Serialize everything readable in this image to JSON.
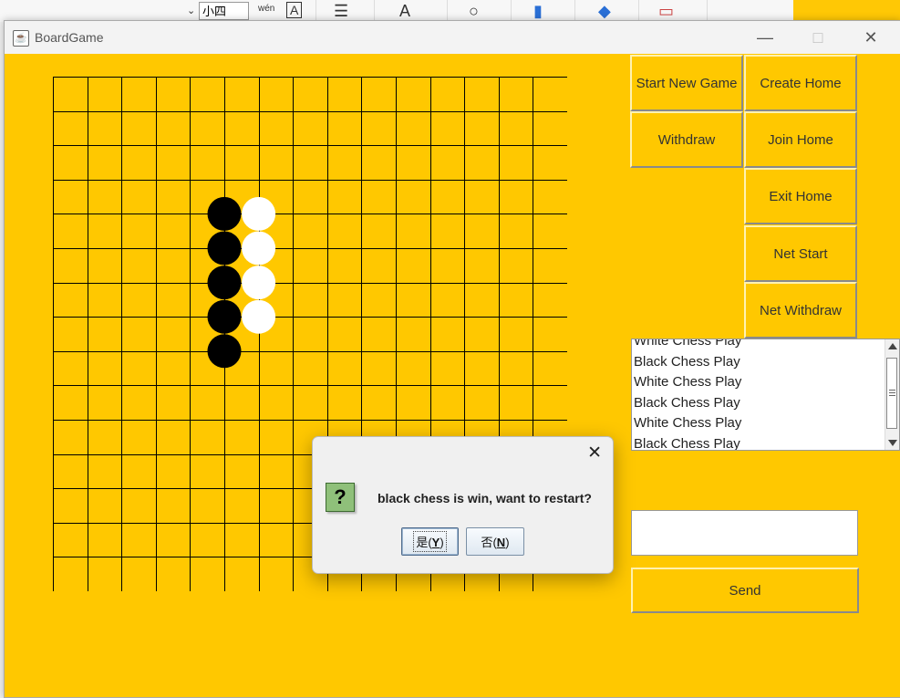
{
  "background_app": {
    "font_size_select": "小四",
    "pinyin_label": "wén",
    "text_icon": "A"
  },
  "window": {
    "title": "BoardGame",
    "icon": "java-cup-icon"
  },
  "board": {
    "grid_lines": 16,
    "stones": [
      {
        "color": "black",
        "col": 5,
        "row": 4
      },
      {
        "color": "white",
        "col": 6,
        "row": 4
      },
      {
        "color": "black",
        "col": 5,
        "row": 5
      },
      {
        "color": "white",
        "col": 6,
        "row": 5
      },
      {
        "color": "black",
        "col": 5,
        "row": 6
      },
      {
        "color": "white",
        "col": 6,
        "row": 6
      },
      {
        "color": "black",
        "col": 5,
        "row": 7
      },
      {
        "color": "white",
        "col": 6,
        "row": 7
      },
      {
        "color": "black",
        "col": 5,
        "row": 8
      }
    ]
  },
  "buttons": {
    "start_new_game": "Start New Game",
    "create_home": "Create Home",
    "withdraw": "Withdraw",
    "join_home": "Join Home",
    "exit_home": "Exit Home",
    "net_start": "Net Start",
    "net_withdraw": "Net Withdraw",
    "send": "Send"
  },
  "log": {
    "items": [
      "White Chess Play",
      "Black Chess Play",
      "White Chess Play",
      "Black Chess Play",
      "White Chess Play",
      "Black Chess Play"
    ]
  },
  "chat": {
    "input_value": ""
  },
  "dialog": {
    "message": "black chess is win, want to restart?",
    "yes_prefix": "是(",
    "yes_key": "Y",
    "yes_suffix": ")",
    "no_prefix": "否(",
    "no_key": "N",
    "no_suffix": ")"
  },
  "colors": {
    "window_bg": "#ffc800",
    "board_line": "#000000",
    "black_stone": "#000000",
    "white_stone": "#ffffff"
  }
}
